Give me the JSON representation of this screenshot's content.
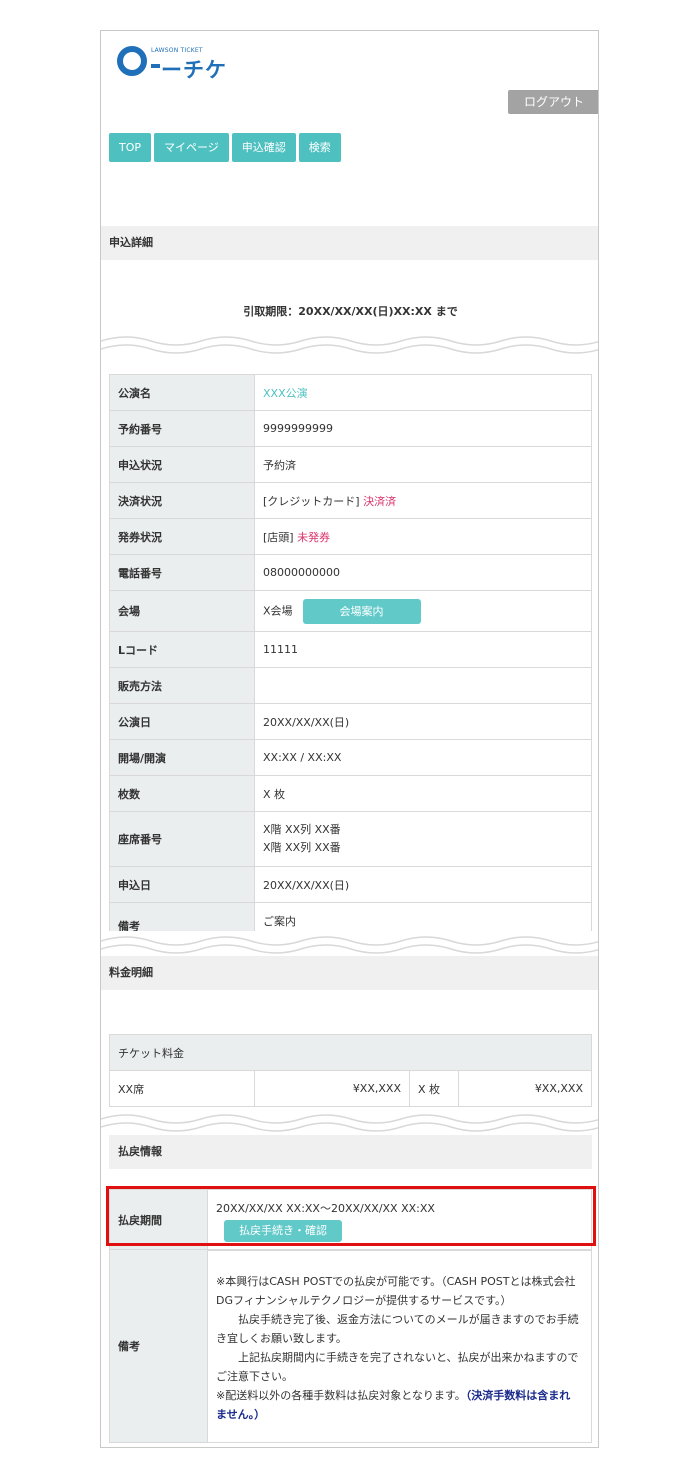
{
  "logo": {
    "brand_small": "LAWSON TICKET",
    "brand_kana": "ーチケ"
  },
  "header": {
    "logout_label": "ログアウト"
  },
  "nav": [
    "TOP",
    "マイページ",
    "申込確認",
    "検索"
  ],
  "section_title": "申込詳細",
  "deadline_text": "引取期限：20XX/XX/XX(日)XX:XX まで",
  "details": {
    "performance": {
      "label": "公演名",
      "value": "XXX公演"
    },
    "reservation_no": {
      "label": "予約番号",
      "value": "9999999999"
    },
    "apply_status": {
      "label": "申込状況",
      "value": "予約済"
    },
    "payment_status": {
      "label": "決済状況",
      "method": "[クレジットカード]",
      "state": "決済済"
    },
    "issue_status": {
      "label": "発券状況",
      "method": "[店頭]",
      "state": "未発券"
    },
    "phone": {
      "label": "電話番号",
      "value": "08000000000"
    },
    "venue": {
      "label": "会場",
      "value": "X会場",
      "button": "会場案内"
    },
    "lcode": {
      "label": "Lコード",
      "value": "11111"
    },
    "sales_method": {
      "label": "販売方法",
      "value": ""
    },
    "show_date": {
      "label": "公演日",
      "value": "20XX/XX/XX(日)"
    },
    "open_start": {
      "label": "開場/開演",
      "value": "XX:XX / XX:XX"
    },
    "count": {
      "label": "枚数",
      "value": "X 枚"
    },
    "seat": {
      "label": "座席番号",
      "line1": "X階 XX列 XX番",
      "line2": "X階 XX列 XX番"
    },
    "apply_date": {
      "label": "申込日",
      "value": "20XX/XX/XX(日)"
    },
    "notes": {
      "label": "備考",
      "value": "ご案内"
    }
  },
  "fee_section_title": "料金明細",
  "fee": {
    "header": "チケット料金",
    "seat": "XX席",
    "unit_price": "¥XX,XXX",
    "count": "X 枚",
    "total": "¥XX,XXX"
  },
  "refund": {
    "title": "払戻情報",
    "period_label": "払戻期間",
    "period_value": "20XX/XX/XX XX:XX～20XX/XX/XX XX:XX",
    "button": "払戻手続き・確認",
    "remarks_label": "備考",
    "remarks_line1": "※本興行はCASH POSTでの払戻が可能です。（CASH POSTとは株式会社DGフィナンシャルテクノロジーが提供するサービスです。）",
    "remarks_line2": "払戻手続き完了後、返金方法についてのメールが届きますのでお手続き宜しくお願い致します。",
    "remarks_line3": "上記払戻期間内に手続きを完了されないと、払戻が出来かねますのでご注意下さい。",
    "remarks_line4": "※配送料以外の各種手数料は払戻対象となります。",
    "remarks_line4_emph": "（決済手数料は含まれません。）"
  },
  "colors": {
    "accent": "#4fc0c0",
    "brand": "#1f6fb9",
    "status_pink": "#d9346b",
    "highlight": "#e01010"
  }
}
